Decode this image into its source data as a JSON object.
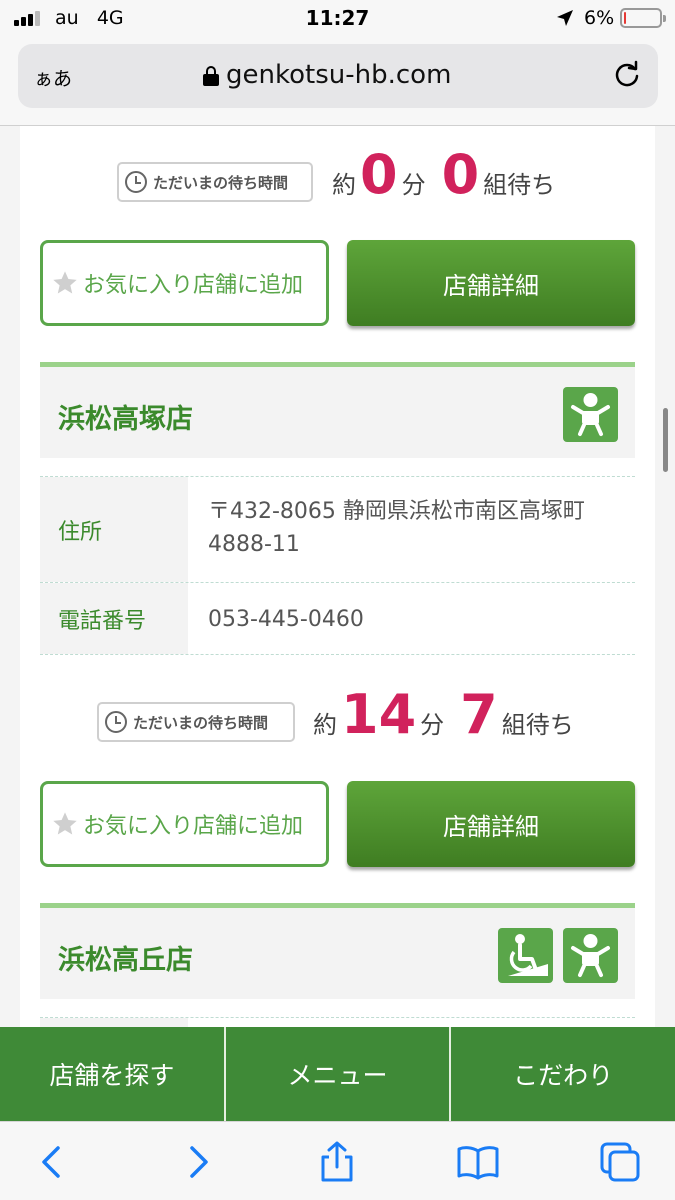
{
  "status_bar": {
    "carrier": "au",
    "network": "4G",
    "time": "11:27",
    "battery": "6%",
    "battery_level": 0.06,
    "battery_color": "#e53935"
  },
  "url_bar": {
    "text_size_label": "ぁあ",
    "url": "genkotsu-hb.com",
    "lock_icon": "lock-icon",
    "reload_icon": "reload-icon"
  },
  "stores": [
    {
      "wait_label": "ただいまの待ち時間",
      "about": "約",
      "minutes": "0",
      "minutes_unit": "分",
      "groups": "0",
      "groups_unit": "組待ち",
      "favorite_label": "お気に入り店舗に追加",
      "detail_label": "店舗詳細"
    },
    {
      "name": "浜松高塚店",
      "badges": [
        "baby-icon"
      ],
      "address_label": "住所",
      "address": "〒432-8065 静岡県浜松市南区高塚町4888-11",
      "phone_label": "電話番号",
      "phone": "053-445-0460",
      "wait_label": "ただいまの待ち時間",
      "about": "約",
      "minutes": "14",
      "minutes_unit": "分",
      "groups": "7",
      "groups_unit": "組待ち",
      "favorite_label": "お気に入り店舗に追加",
      "detail_label": "店舗詳細"
    },
    {
      "name": "浜松高丘店",
      "badges": [
        "wheelchair-icon",
        "baby-icon"
      ]
    }
  ],
  "bottom_nav": {
    "items": [
      "店舗を探す",
      "メニュー",
      "こだわり"
    ]
  },
  "safari_toolbar": {
    "icons": [
      "back-icon",
      "forward-icon",
      "share-icon",
      "bookmarks-icon",
      "tabs-icon"
    ]
  },
  "colors": {
    "accent_green": "#3f8a37",
    "wait_number": "#d1225c"
  }
}
